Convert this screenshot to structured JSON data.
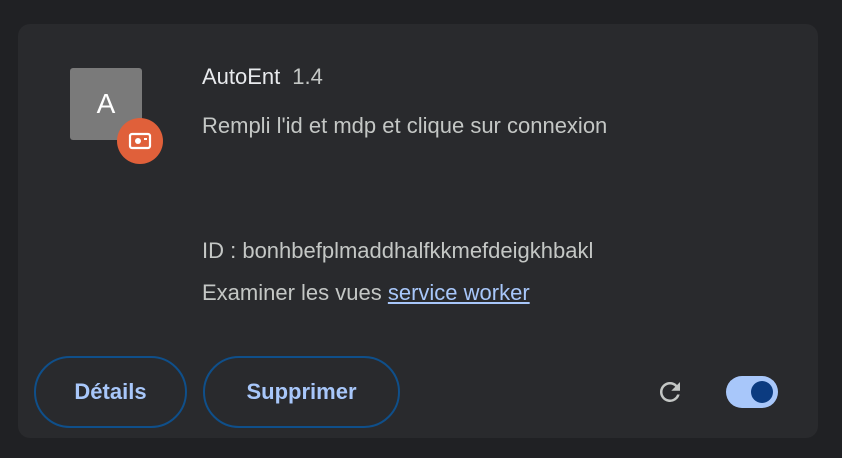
{
  "extension": {
    "icon_letter": "A",
    "name": "AutoEnt",
    "version": "1.4",
    "description": "Rempli l'id et mdp et clique sur connexion",
    "id_line": "ID : bonhbefplmaddhalfkkmefdeigkhbakl",
    "inspect_prefix": "Examiner les vues ",
    "inspect_link": "service worker",
    "enabled": true
  },
  "actions": {
    "details_label": "Détails",
    "remove_label": "Supprimer"
  },
  "colors": {
    "background": "#202124",
    "card": "#292a2d",
    "accent": "#a8c7fa",
    "badge": "#e0603a",
    "button_border": "#0f4f8a"
  },
  "icons": {
    "badge": "unpacked-extension-icon",
    "reload": "reload-icon"
  }
}
